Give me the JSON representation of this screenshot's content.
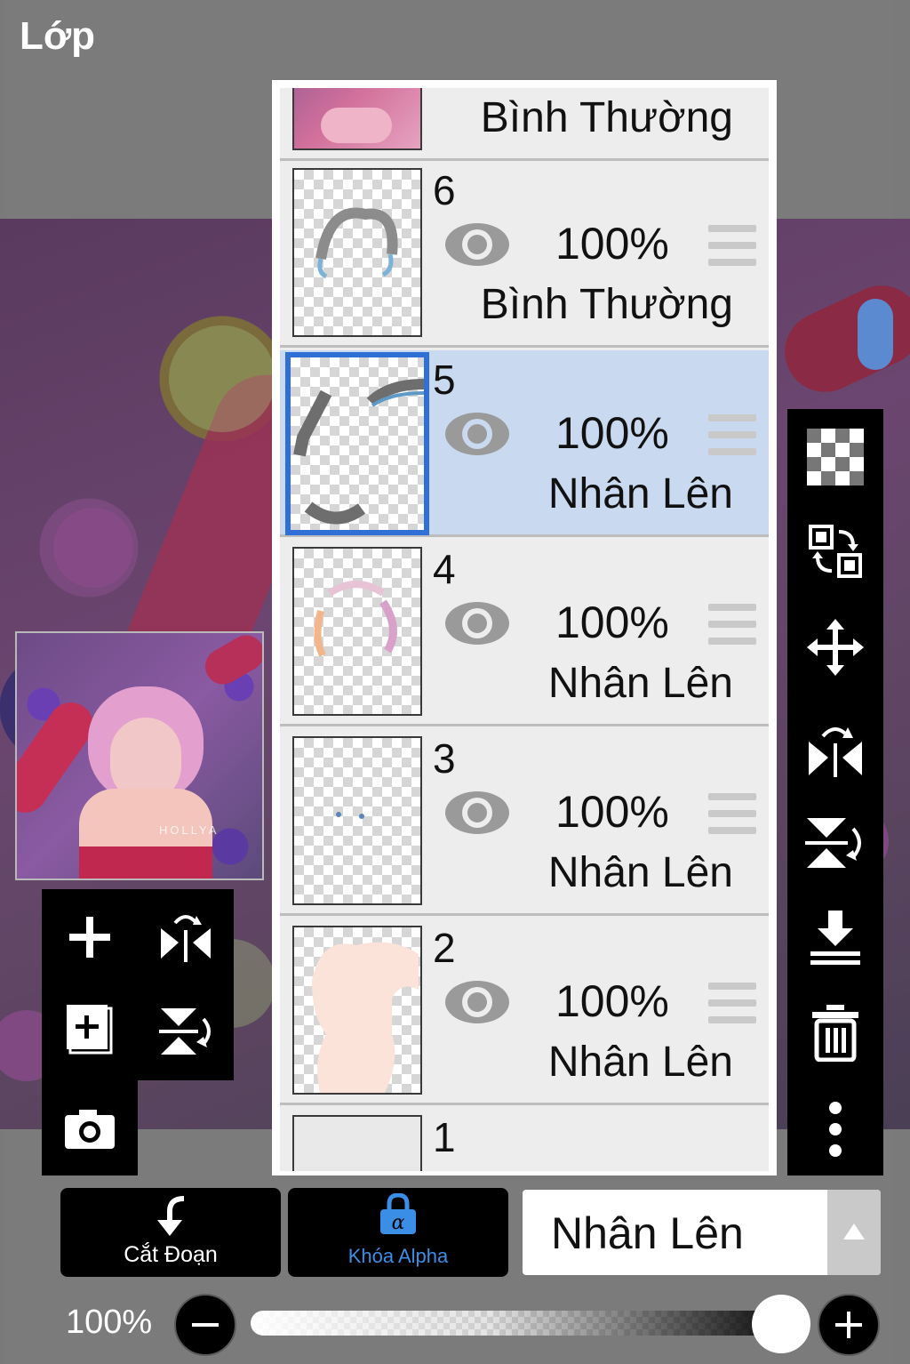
{
  "header": {
    "title": "Lớp"
  },
  "layers": [
    {
      "number": "",
      "opacity": "",
      "blend": "Bình Thường",
      "selected": false,
      "partial": true
    },
    {
      "number": "6",
      "opacity": "100%",
      "blend": "Bình Thường",
      "selected": false
    },
    {
      "number": "5",
      "opacity": "100%",
      "blend": "Nhân Lên",
      "selected": true
    },
    {
      "number": "4",
      "opacity": "100%",
      "blend": "Nhân Lên",
      "selected": false
    },
    {
      "number": "3",
      "opacity": "100%",
      "blend": "Nhân Lên",
      "selected": false
    },
    {
      "number": "2",
      "opacity": "100%",
      "blend": "Nhân Lên",
      "selected": false
    },
    {
      "number": "1",
      "opacity": "",
      "blend": "",
      "selected": false,
      "partial": true
    }
  ],
  "reference": {
    "signature": "HOLLYA"
  },
  "bottom": {
    "clip_label": "Cắt Đoạn",
    "alpha_lock_label": "Khóa Alpha",
    "blend_mode_value": "Nhân Lên",
    "opacity_label": "100%",
    "opacity_value": 1.0
  },
  "colors": {
    "selected_layer_bg": "#c9d9ef",
    "selected_border": "#2f6fd6",
    "alpha_lock_accent": "#3a8ee6"
  },
  "icons": {
    "left_tools": [
      "add-layer-icon",
      "flip-horizontal-icon",
      "add-image-layer-icon",
      "flip-vertical-icon",
      "camera-icon"
    ],
    "right_tools": [
      "transparency-icon",
      "swap-layers-icon",
      "move-icon",
      "flip-horizontal-icon",
      "flip-vertical-icon",
      "merge-down-icon",
      "trash-icon",
      "more-vertical-icon"
    ]
  }
}
